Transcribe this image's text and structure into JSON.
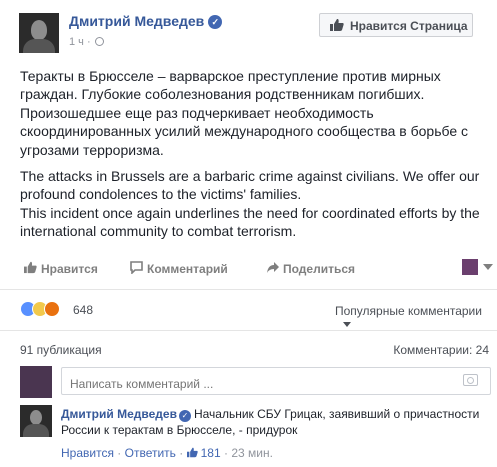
{
  "post": {
    "author": "Дмитрий Медведев",
    "time": "1 ч",
    "like_page_label": "Нравится Страница",
    "paragraphs_ru": [
      "Теракты в Брюсселе – варварское преступление против мирных граждан. Глубокие соболезнования родственникам погибших. Произошедшее еще раз подчеркивает необходимость скоординированных усилий международного сообщества в борьбе с угрозами терроризма."
    ],
    "paragraphs_en": [
      "The attacks in Brussels are a barbaric crime against civilians. We offer our profound condolences to the victims' families.",
      "This incident once again underlines the need for coordinated efforts by the international community to combat terrorism."
    ]
  },
  "actions": {
    "like": "Нравится",
    "comment": "Комментарий",
    "share": "Поделиться"
  },
  "stats": {
    "reactions_count": "648",
    "sort_label": "Популярные комментарии",
    "shares": "91 публикация",
    "comments": "Комментарии: 24"
  },
  "composer": {
    "placeholder": "Написать комментарий ..."
  },
  "comment": {
    "author": "Дмитрий Медведев",
    "text": "Начальник СБУ Грицак, заявивший о причастности России к терактам в Брюсселе, - придурок",
    "like_action": "Нравится",
    "reply_action": "Ответить",
    "likes": "181",
    "time": "23 мин.",
    "separator": "·"
  },
  "colors": {
    "link": "#365899",
    "verified": "#4267b2",
    "muted": "#90949c"
  }
}
